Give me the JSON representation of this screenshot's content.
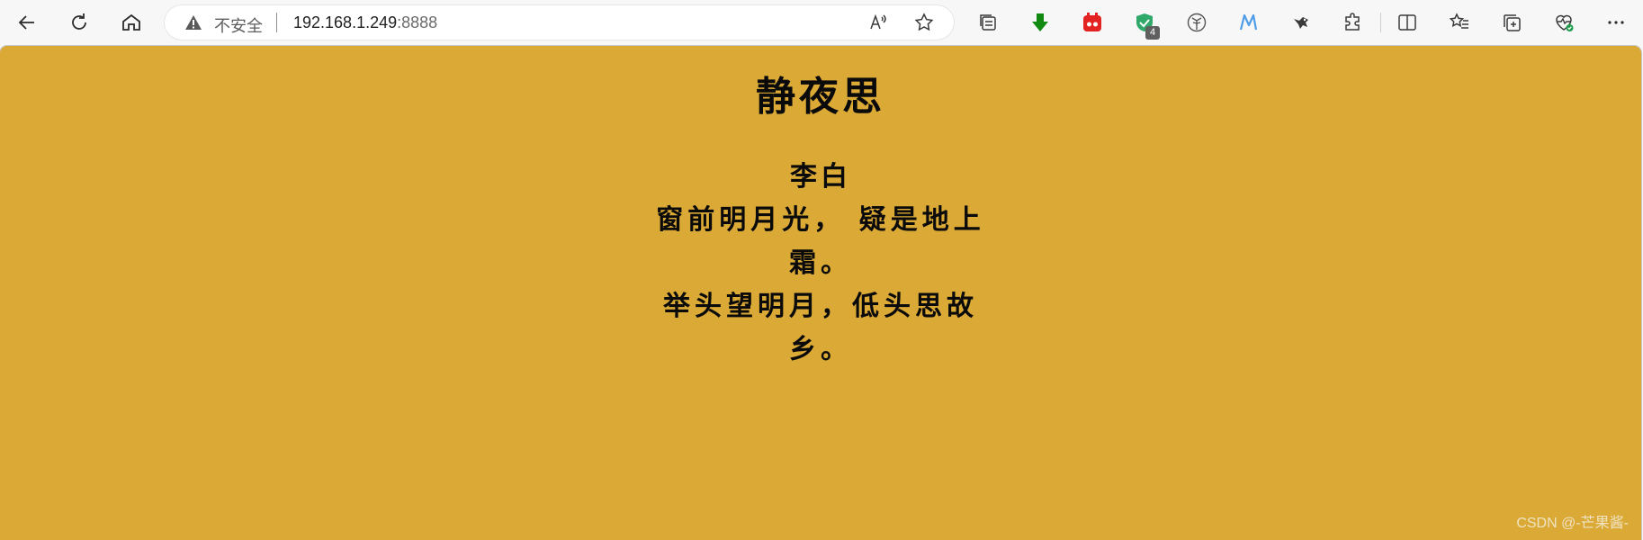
{
  "browser": {
    "address_bar": {
      "security_label": "不安全",
      "url_host": "192.168.1.249",
      "url_port": ":8888"
    },
    "toolbar_icons": [
      "back-arrow-icon",
      "reload-icon",
      "home-icon",
      "read-aloud-icon",
      "favorite-star-icon",
      "tab-actions-icon",
      "download-arrow-icon",
      "red-extension-icon",
      "shield-extension-icon",
      "palm-extension-icon",
      "m-extension-icon",
      "bird-extension-icon",
      "extensions-puzzle-icon",
      "split-screen-icon",
      "favorites-list-icon",
      "collections-icon",
      "browser-health-icon",
      "more-icon"
    ],
    "extension_badge": "4"
  },
  "page": {
    "background_color": "#dba935",
    "title": "静夜思",
    "author": "李白",
    "poem_lines": [
      "窗前明月光， 疑是地上霜。",
      "举头望明月，低头思故乡。"
    ]
  },
  "watermark": "CSDN @-芒果酱-"
}
